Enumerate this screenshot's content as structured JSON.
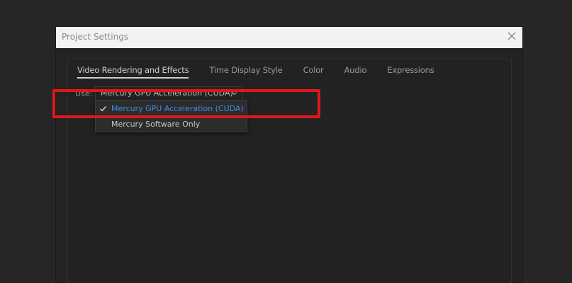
{
  "dialog": {
    "title": "Project Settings",
    "close_icon": "close-icon"
  },
  "tabs": [
    {
      "label": "Video Rendering and Effects",
      "active": true
    },
    {
      "label": "Time Display Style",
      "active": false
    },
    {
      "label": "Color",
      "active": false
    },
    {
      "label": "Audio",
      "active": false
    },
    {
      "label": "Expressions",
      "active": false
    }
  ],
  "renderer": {
    "use_label": "Use:",
    "selected_value": "Mercury GPU Acceleration (CUDA)",
    "options": [
      {
        "label": "Mercury GPU Acceleration (CUDA)",
        "checked": true
      },
      {
        "label": "Mercury Software Only",
        "checked": false
      }
    ]
  },
  "colors": {
    "selected_option": "#3d8ee8",
    "option_text": "#c8c8c8",
    "highlight": "#e0161b"
  }
}
